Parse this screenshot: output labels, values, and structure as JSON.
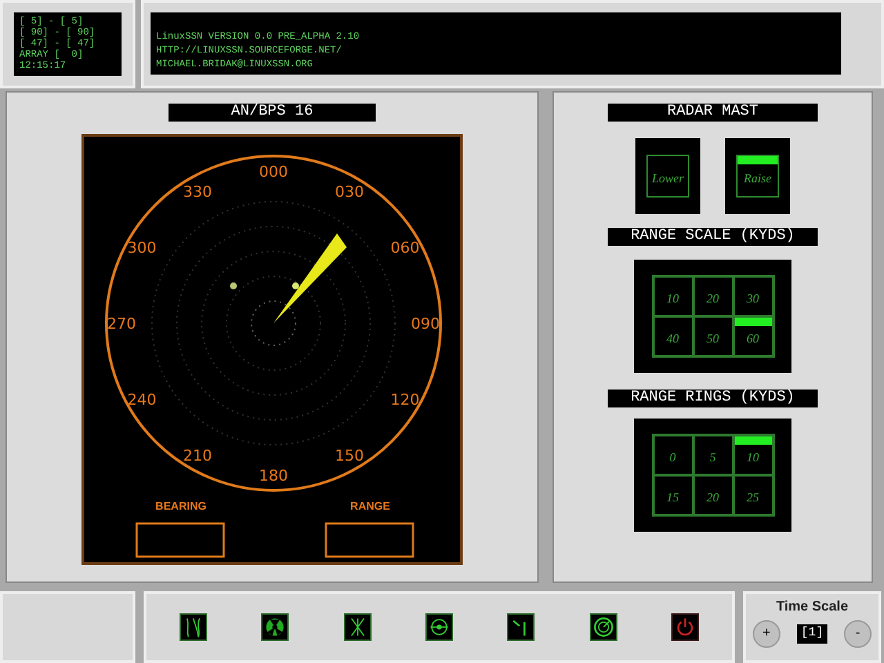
{
  "status_panel": {
    "lines": [
      "[ 5] - [ 5]",
      "[ 90] - [ 90]",
      "[ 47] - [ 47]",
      "ARRAY [  0]",
      "12:15:17"
    ]
  },
  "info_panel": {
    "lines": [
      "LinuxSSN VERSION 0.0 PRE_ALPHA 2.10",
      "HTTP://LINUXSSN.SOURCEFORGE.NET/",
      "MICHAEL.BRIDAK@LINUXSSN.ORG"
    ]
  },
  "radar": {
    "title": "AN/BPS 16",
    "bearings": [
      "000",
      "030",
      "060",
      "090",
      "120",
      "150",
      "180",
      "210",
      "240",
      "270",
      "300",
      "330"
    ],
    "bearing_label": "BEARING",
    "range_label": "RANGE"
  },
  "radar_mast": {
    "title": "RADAR MAST",
    "buttons": [
      {
        "label": "Lower",
        "selected": false
      },
      {
        "label": "Raise",
        "selected": true
      }
    ]
  },
  "range_scale": {
    "title": "RANGE SCALE (KYDS)",
    "options": [
      {
        "label": "10",
        "selected": false
      },
      {
        "label": "20",
        "selected": false
      },
      {
        "label": "30",
        "selected": false
      },
      {
        "label": "40",
        "selected": false
      },
      {
        "label": "50",
        "selected": false
      },
      {
        "label": "60",
        "selected": true
      }
    ]
  },
  "range_rings": {
    "title": "RANGE RINGS (KYDS)",
    "options": [
      {
        "label": "0",
        "selected": false
      },
      {
        "label": "5",
        "selected": false
      },
      {
        "label": "10",
        "selected": true
      },
      {
        "label": "15",
        "selected": false
      },
      {
        "label": "20",
        "selected": false
      },
      {
        "label": "25",
        "selected": false
      }
    ]
  },
  "time_scale": {
    "title": "Time Scale",
    "increase": "+",
    "value": "[1]",
    "decrease": "-"
  }
}
